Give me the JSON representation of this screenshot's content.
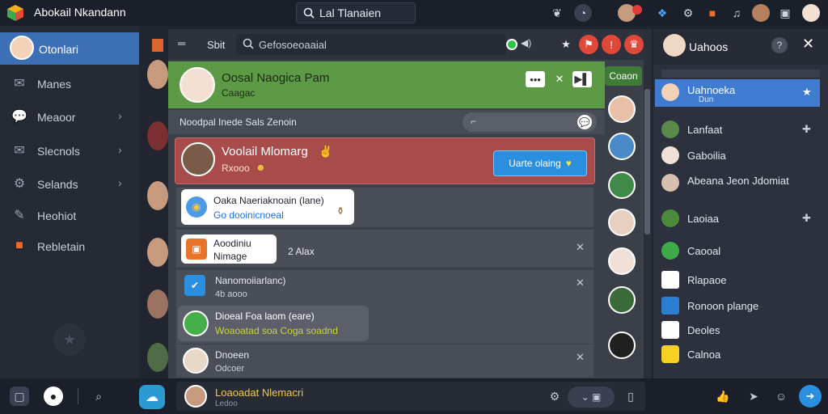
{
  "app": {
    "title": "Abokail Nkandann"
  },
  "top_search": {
    "value": "Lal Tlanaien"
  },
  "sidebar": {
    "profile_label": "Otonlari",
    "items": [
      {
        "label": "Manes",
        "icon": "envelope-icon"
      },
      {
        "label": "Meaoor",
        "icon": "chat-bubble-icon"
      },
      {
        "label": "Slecnols",
        "icon": "envelope-icon"
      },
      {
        "label": "Selands",
        "icon": "gear-icon"
      },
      {
        "label": "Heohiot",
        "icon": "edit-icon"
      },
      {
        "label": "Rebletain",
        "icon": "orange-app-icon"
      }
    ]
  },
  "main": {
    "toolbar_label": "Sbit",
    "search_value": "Gefosoeoaaial"
  },
  "banner": {
    "title": "Oosal Naogica Pam",
    "subtitle": "Caagac"
  },
  "open_button": "Coaon",
  "subheader": {
    "label": "Noodpal Inede Sals Zenoin"
  },
  "highlight": {
    "title": "Voolail Mlomarg",
    "subtitle": "Rxooo",
    "button": "Uarte olaing"
  },
  "messages": [
    {
      "line1": "Oaka Naeriaknoain (lane)",
      "line2": "Go dooinicnoeal",
      "line2_color": "#1f6fe0"
    },
    {
      "line1": "Aoodiniu",
      "line2": "Nimage",
      "side": "2 Alax"
    },
    {
      "line1": "Nanomoiiarlanc)",
      "line2": "4b aooo"
    },
    {
      "line1": "Dioeal Foa laom (eare)",
      "line2": "Woaoatad soa Coga soadnd",
      "line2_color": "#c8d830"
    },
    {
      "line1": "Dnoeen",
      "line2": "Odcoer"
    }
  ],
  "contacts": {
    "title": "Uahoos",
    "items": [
      {
        "label": "Uahnoeka",
        "sub": "Dun"
      },
      {
        "label": "Lanfaat"
      },
      {
        "label": "Gaboilia"
      },
      {
        "label": "Abeana Jeon Jdomiat"
      },
      {
        "label": "Laoiaa"
      },
      {
        "label": "Caooal"
      },
      {
        "label": "Rlapaoe"
      },
      {
        "label": "Ronoon plange"
      },
      {
        "label": "Deoles"
      },
      {
        "label": "Calnoa"
      }
    ]
  },
  "bottom": {
    "composer_text": "Loaoadat Nlemacri",
    "composer_sub": "Ledoo"
  },
  "colors": {
    "accent": "#3d6fb5",
    "banner_green": "#5d9a46",
    "highlight_red": "#a84b4b",
    "button_blue": "#2b8fe0"
  }
}
